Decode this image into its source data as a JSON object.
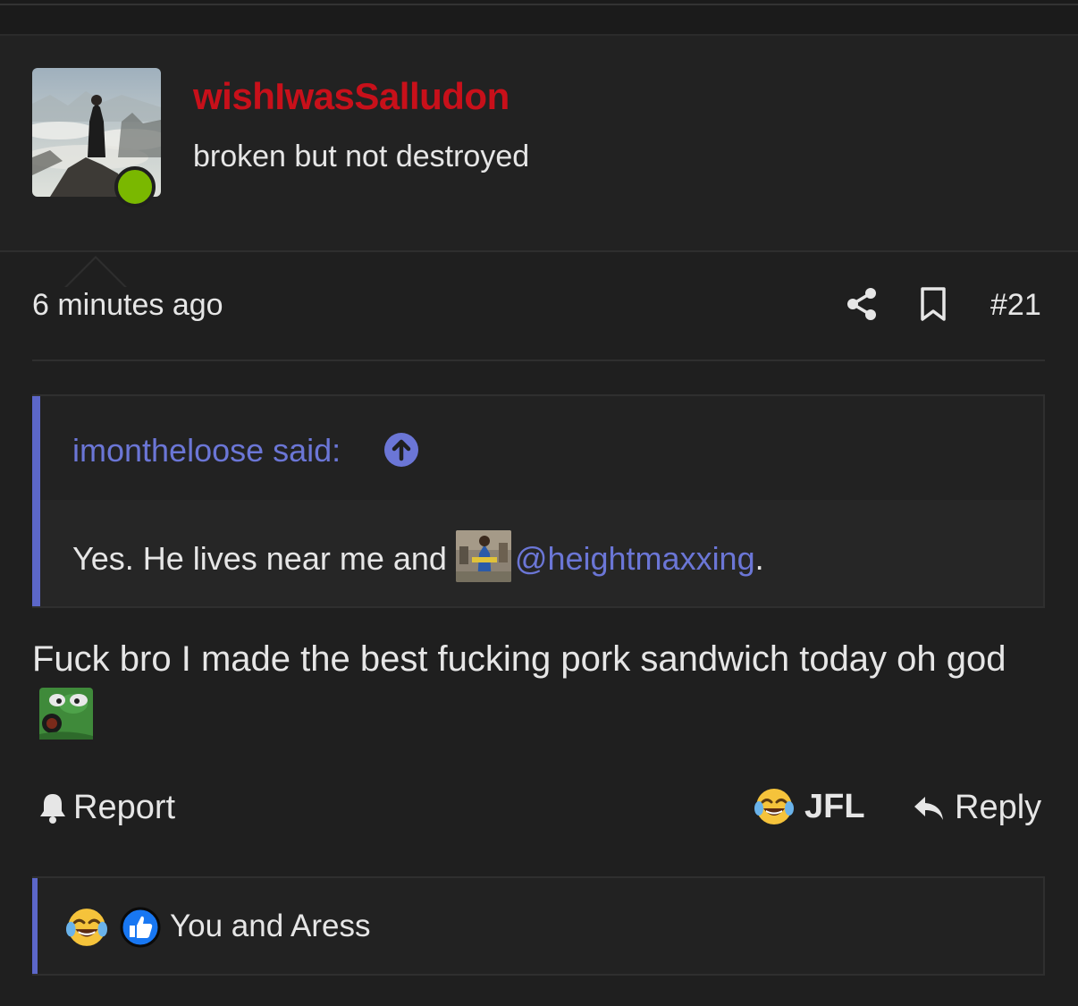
{
  "user": {
    "name": "wishIwasSalludon",
    "title": "broken but not destroyed",
    "status_color": "#7ab800",
    "name_color": "#c8101a"
  },
  "post": {
    "time": "6 minutes ago",
    "number": "#21",
    "message": "Fuck bro I made the best fucking pork sandwich today oh god"
  },
  "quote": {
    "author": "imontheloose said:",
    "text": "Yes. He lives near me and",
    "mention": "@heightmaxxing",
    "after": "."
  },
  "actions": {
    "report": "Report",
    "jfl": "JFL",
    "reply": "Reply"
  },
  "reactions": {
    "text": "You and Aress",
    "icons": [
      "laugh-cry-emoji-icon",
      "thumbs-up-icon"
    ]
  },
  "colors": {
    "accent": "#5c67c9",
    "link": "#6b76d6",
    "background": "#1f1f1f"
  }
}
